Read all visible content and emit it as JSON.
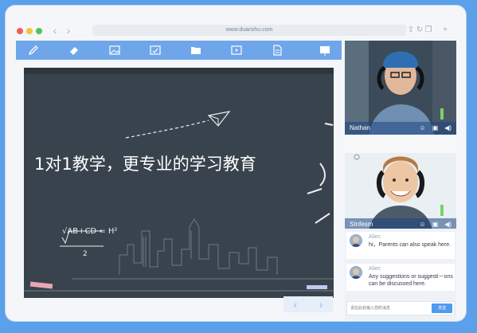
{
  "window": {
    "url": "www.duanshu.com",
    "nav_back": "‹",
    "nav_forward": "›",
    "share_glyph": "⇪",
    "reload_glyph": "↻",
    "tabs_glyph": "❐",
    "new_tab_glyph": "+"
  },
  "toolbar": {
    "tools": [
      "pen-icon",
      "eraser-icon",
      "image-icon",
      "screen-icon",
      "folder-icon",
      "video-icon",
      "document-icon",
      "whiteboard-icon"
    ]
  },
  "board": {
    "headline": "1对1教学，更专业的学习教育",
    "formula": "√AB+CD = H²"
  },
  "pager": {
    "prev": "‹",
    "next": "›"
  },
  "videos": [
    {
      "name": "Nathan"
    },
    {
      "name": "Stnfesm"
    }
  ],
  "chat": {
    "messages": [
      {
        "author": "Aliec",
        "text": "hi，Parents can also speak here."
      },
      {
        "author": "Aliec",
        "text": "Any suggestions or suggesti－ons can be discussed here."
      }
    ],
    "input_placeholder": "请在此处输入您的消息",
    "send_label": "发送"
  },
  "colors": {
    "background": "#5aa0ea",
    "toolbar": "#6fa6ea",
    "board": "#39434d",
    "accent": "#4e9bf0"
  }
}
